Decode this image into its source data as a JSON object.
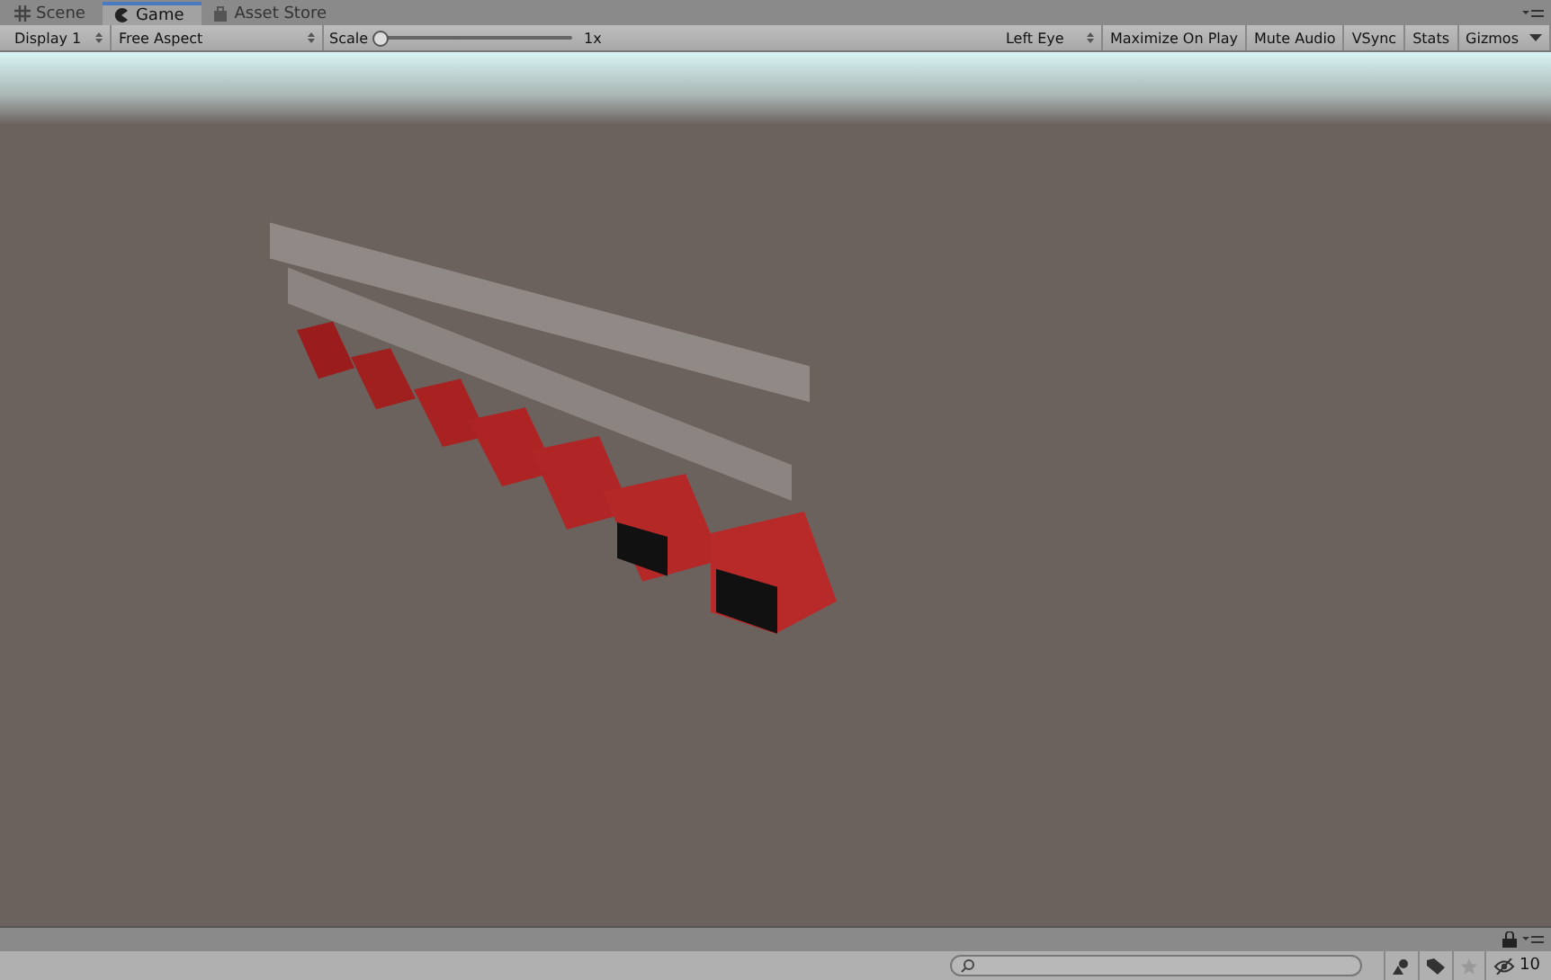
{
  "tabs": [
    {
      "label": "Scene",
      "selected": false
    },
    {
      "label": "Game",
      "selected": true
    },
    {
      "label": "Asset Store",
      "selected": false
    }
  ],
  "toolbar": {
    "display": "Display 1",
    "aspect": "Free Aspect",
    "scale_label": "Scale",
    "scale": {
      "level": 0
    },
    "scale_reading": "1x",
    "eye": "Left Eye",
    "toggles": [
      {
        "label": "Maximize On Play",
        "on": false
      },
      {
        "label": "Mute Audio",
        "on": false
      },
      {
        "label": "VSync",
        "on": false
      },
      {
        "label": "Stats",
        "on": false
      }
    ],
    "gizmos": "Gizmos"
  },
  "bottom_panel": {
    "hidden_count": "10"
  }
}
